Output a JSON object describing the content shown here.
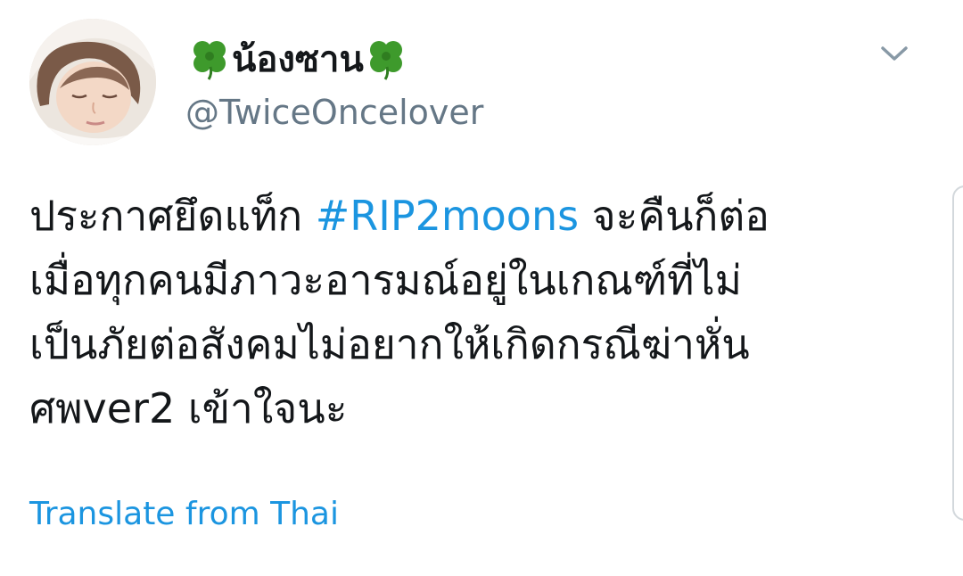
{
  "tweet": {
    "display_name": "น้องซาน",
    "name_emoji_left": "four-leaf-clover-emoji",
    "name_emoji_right": "four-leaf-clover-emoji",
    "handle": "@TwiceOncelover",
    "body": {
      "line1_before": "ประกาศยึดแท็ก ",
      "hashtag": "#RIP2moons",
      "line1_after": " จะคืนก็ต่อ",
      "line2": "เมื่อทุกคนมีภาวะอารมณ์อยู่ในเกณฑ์ที่ไม่",
      "line3": "เป็นภัยต่อสังคมไม่อยากให้เกิดกรณีฆ่าหั่น",
      "line4": "ศพver2 เข้าใจนะ"
    },
    "translate_label": "Translate from Thai",
    "menu_icon": "chevron-down-icon"
  },
  "colors": {
    "text": "#14171a",
    "secondary_text": "#657786",
    "link": "#1b95e0",
    "background": "#ffffff"
  }
}
